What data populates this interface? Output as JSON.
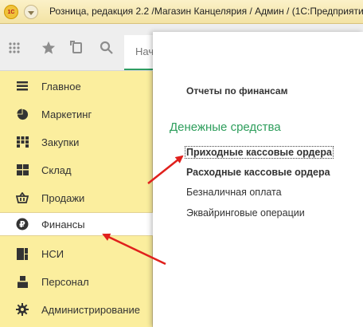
{
  "titlebar": {
    "logo_text": "1С",
    "title": "Розница, редакция 2.2 /Магазин Канцелярия / Админ /  (1С:Предприятие)"
  },
  "toolbar": {
    "icons": [
      "grid-icon",
      "star-icon",
      "history-icon",
      "search-icon"
    ],
    "tab_start_label": "Нач"
  },
  "sidebar": {
    "items": [
      {
        "label": "Главное",
        "icon": "menu-lines-icon",
        "active": false
      },
      {
        "label": "Маркетинг",
        "icon": "pie-chart-icon",
        "active": false
      },
      {
        "label": "Закупки",
        "icon": "purchases-grid-icon",
        "active": false
      },
      {
        "label": "Склад",
        "icon": "warehouse-icon",
        "active": false
      },
      {
        "label": "Продажи",
        "icon": "basket-icon",
        "active": false
      },
      {
        "label": "Финансы",
        "icon": "ruble-icon",
        "active": true
      },
      {
        "label": "НСИ",
        "icon": "reference-data-icon",
        "active": false
      },
      {
        "label": "Персонал",
        "icon": "person-icon",
        "active": false
      },
      {
        "label": "Администрирование",
        "icon": "gear-icon",
        "active": false
      }
    ]
  },
  "panel": {
    "section_title": "Отчеты по финансам",
    "group_title": "Денежные средства",
    "links": [
      {
        "label": "Приходные кассовые ордера",
        "bold": true,
        "highlighted": true
      },
      {
        "label": "Расходные кассовые ордера",
        "bold": true,
        "highlighted": false
      },
      {
        "label": "Безналичная оплата",
        "bold": false,
        "highlighted": false
      },
      {
        "label": "Эквайринговые операции",
        "bold": false,
        "highlighted": false
      }
    ]
  },
  "colors": {
    "sidebar_bg": "#fbee9e",
    "accent_green": "#2e9e5c",
    "annotation_arrow": "#e0201c"
  }
}
